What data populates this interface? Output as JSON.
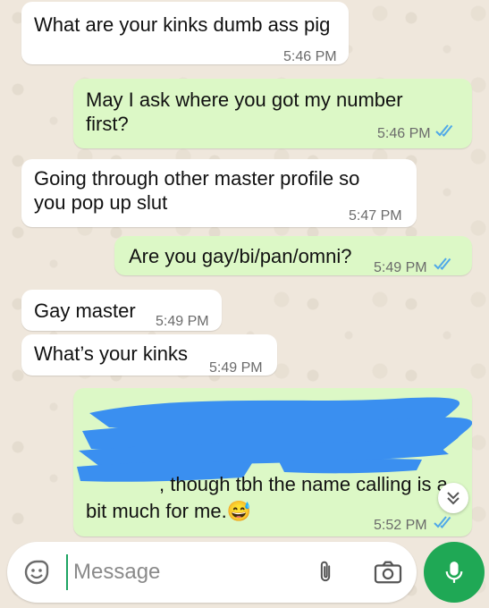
{
  "messages": [
    {
      "text": "What are your kinks dumb ass pig",
      "time": "5:46 PM"
    },
    {
      "text": "May I ask where you got my number\nfirst?",
      "time": "5:46 PM"
    },
    {
      "text": "Going through other master profile so\nyou pop up slut",
      "time": "5:47 PM"
    },
    {
      "text": "Are you gay/bi/pan/omni?",
      "time": "5:49 PM"
    },
    {
      "text": "Gay master",
      "time": "5:49 PM"
    },
    {
      "text": "What’s your kinks",
      "time": "5:49 PM"
    },
    {
      "text_visible_line1": ", though tbh the name calling is a",
      "text_visible_line2": "bit much for me.😅",
      "time": "5:52 PM",
      "redacted": true
    }
  ],
  "composer": {
    "placeholder": "Message"
  },
  "icons": {
    "emoji": "emoji-sticker-icon",
    "attach": "paperclip-icon",
    "camera": "camera-icon",
    "mic": "microphone-icon",
    "scroll": "chevron-double-down-icon",
    "read": "double-check-icon"
  },
  "colors": {
    "outgoing": "#dcf8c6",
    "incoming": "#ffffff",
    "read_tick": "#4fa8e8",
    "mic": "#1fa855",
    "redaction": "#3a8ff0"
  }
}
